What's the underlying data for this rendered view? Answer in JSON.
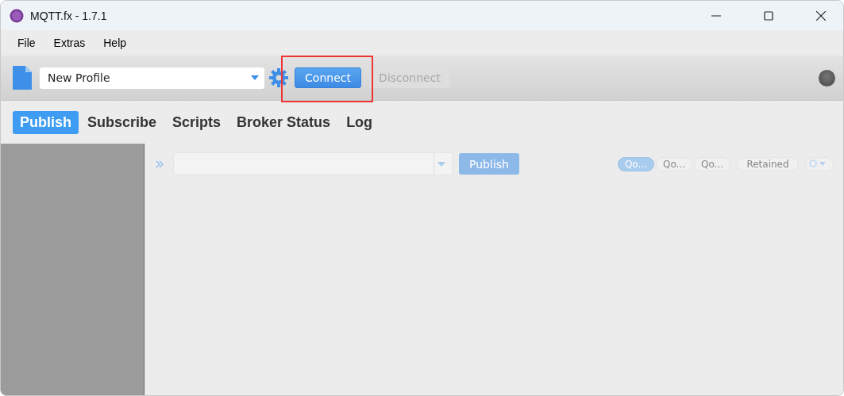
{
  "window": {
    "title": "MQTT.fx - 1.7.1"
  },
  "menu": [
    "File",
    "Extras",
    "Help"
  ],
  "toolbar": {
    "profile": "New Profile",
    "connect": "Connect",
    "disconnect": "Disconnect",
    "disconnect_disabled": true,
    "connected": false,
    "highlight_connect": true
  },
  "tabs": [
    {
      "label": "Publish",
      "selected": true
    },
    {
      "label": "Subscribe",
      "selected": false
    },
    {
      "label": "Scripts",
      "selected": false
    },
    {
      "label": "Broker Status",
      "selected": false
    },
    {
      "label": "Log",
      "selected": false
    }
  ],
  "publish": {
    "button": "Publish",
    "disabled": true,
    "qos": [
      {
        "label": "Qo...",
        "selected": true
      },
      {
        "label": "Qo...",
        "selected": false
      },
      {
        "label": "Qo...",
        "selected": false
      }
    ],
    "retained": {
      "label": "Retained",
      "selected": false
    }
  }
}
